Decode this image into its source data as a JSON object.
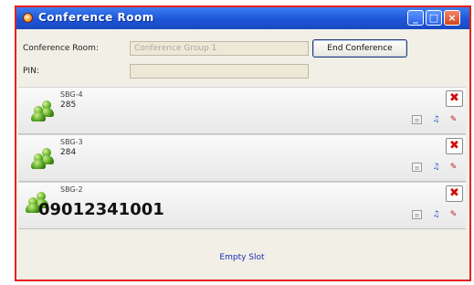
{
  "window": {
    "title": "Conference Room",
    "controls": {
      "minimize": "_",
      "maximize": "□",
      "close": "×"
    }
  },
  "form": {
    "room_label": "Conference Room:",
    "room_value": "Conference Group 1",
    "pin_label": "PIN:",
    "pin_value": "",
    "end_button": "End Conference"
  },
  "slots": [
    {
      "name": "SBG-4",
      "ext": "285"
    },
    {
      "name": "SBG-3",
      "ext": "284"
    },
    {
      "name": "SBG-2",
      "ext": "09012341001"
    }
  ],
  "slot_icons": {
    "remove": "✖",
    "doc": "≡",
    "note": "♫",
    "plug": "✎"
  },
  "empty_slot": "Empty Slot",
  "colors": {
    "titlebar": "#1d55d8",
    "border": "#e6201d",
    "remove": "#d21010",
    "empty_text": "#1d2db8",
    "people": "#5aa71f"
  }
}
